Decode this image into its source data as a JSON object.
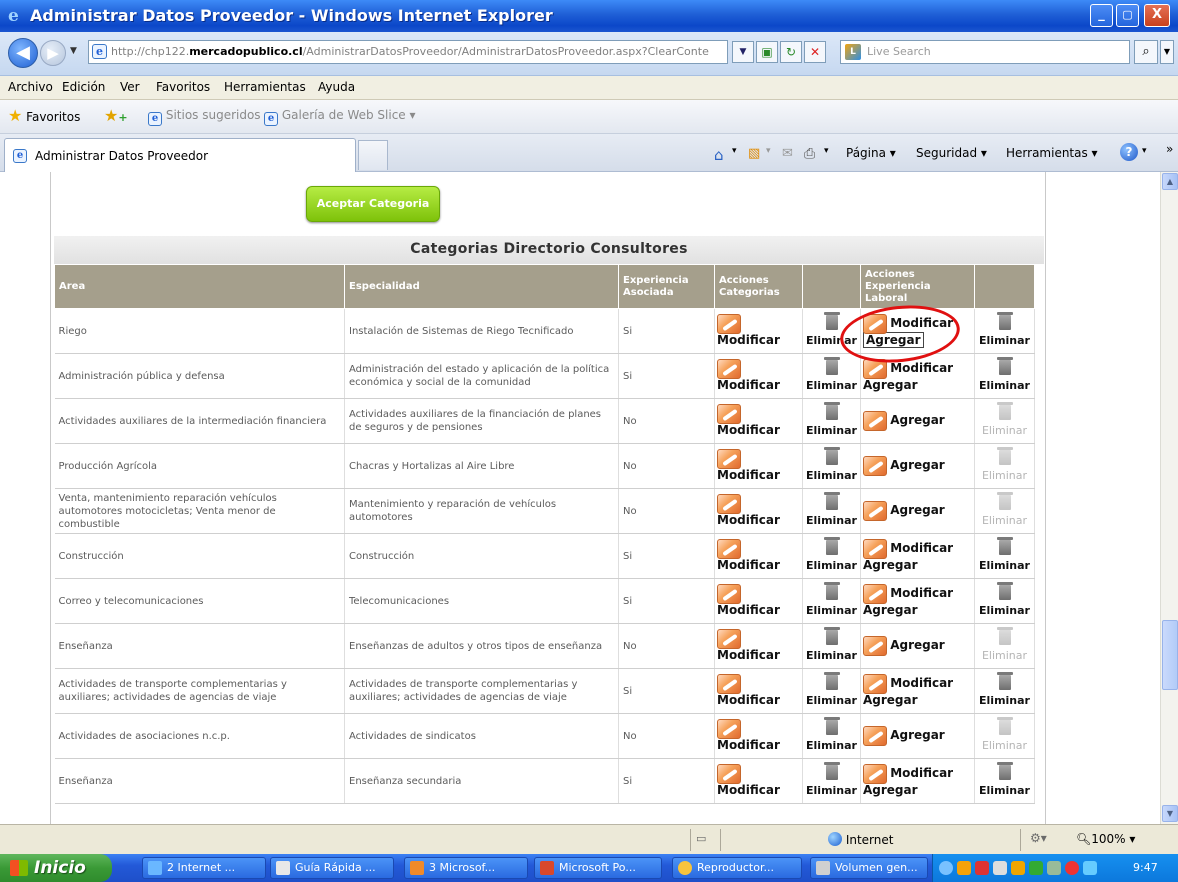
{
  "window": {
    "title": "Administrar Datos Proveedor - Windows Internet Explorer",
    "minimize": "_",
    "maximize": "▢",
    "close": "X"
  },
  "address": {
    "prefix": "http://chp122.",
    "domain": "mercadopublico.cl",
    "path": "/AdministrarDatosProveedor/AdministrarDatosProveedor.aspx?ClearConte",
    "search_placeholder": "Live Search"
  },
  "menu": [
    "Archivo",
    "Edición",
    "Ver",
    "Favoritos",
    "Herramientas",
    "Ayuda"
  ],
  "favorites": {
    "label": "Favoritos",
    "items": [
      "Sitios sugeridos ▾",
      "Galería de Web Slice ▾"
    ]
  },
  "tab": {
    "title": "Administrar Datos Proveedor"
  },
  "commandbar": {
    "pagina": "Página ▾",
    "seguridad": "Seguridad ▾",
    "herramientas": "Herramientas ▾"
  },
  "page": {
    "accept_button": "Aceptar Categoria",
    "section_title": "Categorias Directorio Consultores",
    "headers": [
      "Area",
      "Especialidad",
      "Experiencia Asociada",
      "Acciones Categorias",
      "",
      "Acciones Experiencia Laboral",
      ""
    ],
    "labels": {
      "modificar": "Modificar",
      "eliminar": "Eliminar",
      "agregar": "Agregar"
    },
    "rows": [
      {
        "area": "Riego",
        "especialidad": "Instalación de Sistemas de Riego Tecnificado",
        "exp": "Si",
        "exp_mod": true
      },
      {
        "area": "Administración pública y defensa",
        "especialidad": "Administración del estado y aplicación de la política económica y social de la comunidad",
        "exp": "Si",
        "exp_mod": true
      },
      {
        "area": "Actividades auxiliares de la intermediación financiera",
        "especialidad": "Actividades auxiliares de la financiación de planes de seguros y de pensiones",
        "exp": "No",
        "exp_mod": false
      },
      {
        "area": "Producción Agrícola",
        "especialidad": "Chacras y Hortalizas al Aire Libre",
        "exp": "No",
        "exp_mod": false
      },
      {
        "area": "Venta, mantenimiento reparación vehículos automotores motocicletas; Venta menor de combustible",
        "especialidad": "Mantenimiento y reparación de vehículos automotores",
        "exp": "No",
        "exp_mod": false
      },
      {
        "area": "Construcción",
        "especialidad": "Construcción",
        "exp": "Si",
        "exp_mod": true
      },
      {
        "area": "Correo y telecomunicaciones",
        "especialidad": "Telecomunicaciones",
        "exp": "Si",
        "exp_mod": true
      },
      {
        "area": "Enseñanza",
        "especialidad": "Enseñanzas de adultos y otros tipos de enseñanza",
        "exp": "No",
        "exp_mod": false
      },
      {
        "area": "Actividades de transporte complementarias y auxiliares; actividades de agencias de viaje",
        "especialidad": "Actividades de transporte complementarias y auxiliares; actividades de agencias de viaje",
        "exp": "Si",
        "exp_mod": true
      },
      {
        "area": "Actividades de asociaciones n.c.p.",
        "especialidad": "Actividades de sindicatos",
        "exp": "No",
        "exp_mod": false
      },
      {
        "area": "Enseñanza",
        "especialidad": "Enseñanza secundaria",
        "exp": "Si",
        "exp_mod": true
      }
    ]
  },
  "status": {
    "zone": "Internet",
    "zoom": "100%"
  },
  "taskbar": {
    "start": "Inicio",
    "items": [
      "2 Internet ...",
      "Guía Rápida ...",
      "3 Microsof...",
      "Microsoft Po...",
      "Reproductor...",
      "Volumen gen..."
    ],
    "clock": "9:47"
  },
  "colors": {
    "header_bg": "#a59f8c",
    "accept_button": "#8fd11a",
    "highlight_circle": "#e01010"
  }
}
